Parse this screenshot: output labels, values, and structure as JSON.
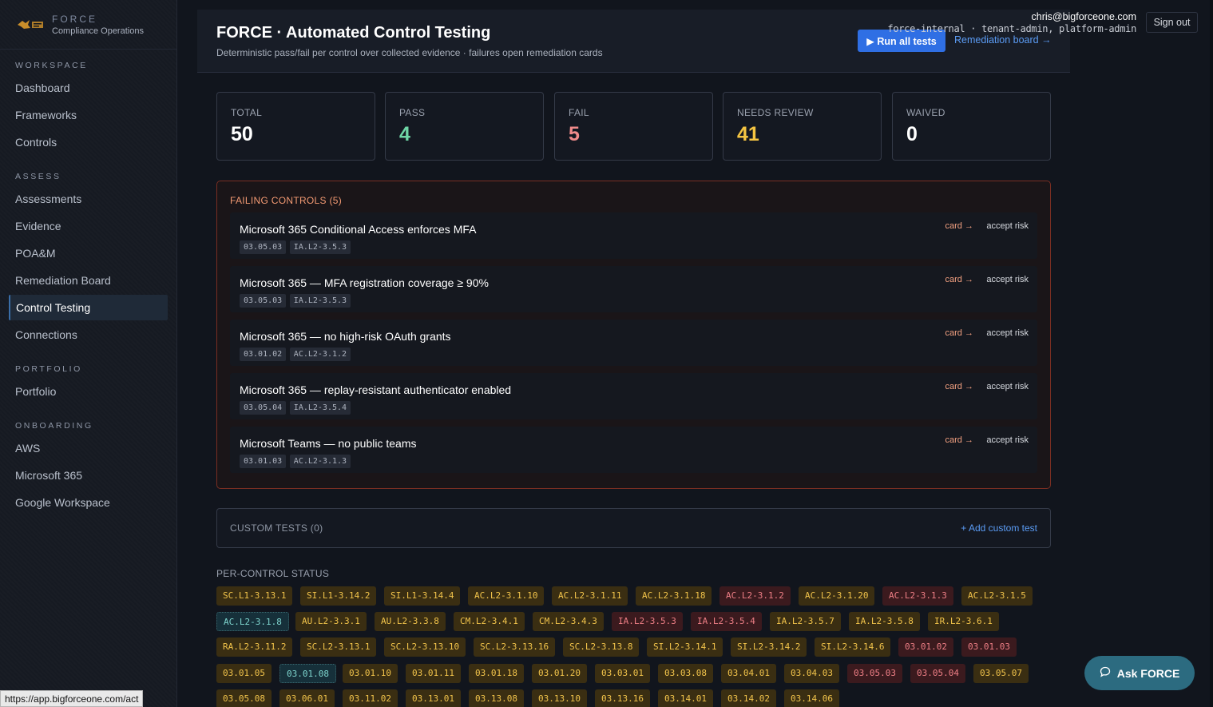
{
  "brand": {
    "name": "FORCE",
    "subtitle": "Compliance Operations"
  },
  "sidebar": {
    "sections": [
      {
        "label": "WORKSPACE",
        "items": [
          "Dashboard",
          "Frameworks",
          "Controls"
        ]
      },
      {
        "label": "ASSESS",
        "items": [
          "Assessments",
          "Evidence",
          "POA&M",
          "Remediation Board",
          "Control Testing",
          "Connections"
        ]
      },
      {
        "label": "PORTFOLIO",
        "items": [
          "Portfolio"
        ]
      },
      {
        "label": "ONBOARDING",
        "items": [
          "AWS",
          "Microsoft 365",
          "Google Workspace"
        ]
      }
    ],
    "active": "Control Testing"
  },
  "header": {
    "title": "FORCE · Automated Control Testing",
    "subtitle": "Deterministic pass/fail per control over collected evidence · failures open remediation cards",
    "run_button": "▶ Run all tests",
    "remediation_link": "Remediation board →"
  },
  "user": {
    "email": "chris@bigforceone.com",
    "roles": "force-internal · tenant-admin, platform-admin",
    "signout": "Sign out"
  },
  "stats": [
    {
      "label": "TOTAL",
      "value": "50",
      "color": "#ffffff"
    },
    {
      "label": "PASS",
      "value": "4",
      "color": "#6fd6a6"
    },
    {
      "label": "FAIL",
      "value": "5",
      "color": "#f08b8b"
    },
    {
      "label": "NEEDS REVIEW",
      "value": "41",
      "color": "#f5c542"
    },
    {
      "label": "WAIVED",
      "value": "0",
      "color": "#ffffff"
    }
  ],
  "failing": {
    "title": "FAILING CONTROLS (5)",
    "card_label": "card →",
    "accept_label": "accept risk",
    "rows": [
      {
        "name": "Microsoft 365 Conditional Access enforces MFA",
        "tags": [
          "03.05.03",
          "IA.L2-3.5.3"
        ]
      },
      {
        "name": "Microsoft 365 — MFA registration coverage ≥ 90%",
        "tags": [
          "03.05.03",
          "IA.L2-3.5.3"
        ]
      },
      {
        "name": "Microsoft 365 — no high-risk OAuth grants",
        "tags": [
          "03.01.02",
          "AC.L2-3.1.2"
        ]
      },
      {
        "name": "Microsoft 365 — replay-resistant authenticator enabled",
        "tags": [
          "03.05.04",
          "IA.L2-3.5.4"
        ]
      },
      {
        "name": "Microsoft Teams — no public teams",
        "tags": [
          "03.01.03",
          "AC.L2-3.1.3"
        ]
      }
    ]
  },
  "custom_tests": {
    "title": "CUSTOM TESTS (0)",
    "add_label": "+ Add custom test"
  },
  "per_control": {
    "title": "PER-CONTROL STATUS",
    "rows": [
      [
        [
          "SC.L1-3.13.1",
          "warn"
        ],
        [
          "SI.L1-3.14.2",
          "warn"
        ],
        [
          "SI.L1-3.14.4",
          "warn"
        ],
        [
          "AC.L2-3.1.10",
          "warn"
        ],
        [
          "AC.L2-3.1.11",
          "warn"
        ],
        [
          "AC.L2-3.1.18",
          "warn"
        ],
        [
          "AC.L2-3.1.2",
          "fail"
        ],
        [
          "AC.L2-3.1.20",
          "warn"
        ],
        [
          "AC.L2-3.1.3",
          "fail"
        ],
        [
          "AC.L2-3.1.5",
          "warn"
        ]
      ],
      [
        [
          "AC.L2-3.1.8",
          "pass"
        ],
        [
          "AU.L2-3.3.1",
          "warn"
        ],
        [
          "AU.L2-3.3.8",
          "warn"
        ],
        [
          "CM.L2-3.4.1",
          "warn"
        ],
        [
          "CM.L2-3.4.3",
          "warn"
        ],
        [
          "IA.L2-3.5.3",
          "fail"
        ],
        [
          "IA.L2-3.5.4",
          "fail"
        ],
        [
          "IA.L2-3.5.7",
          "warn"
        ],
        [
          "IA.L2-3.5.8",
          "warn"
        ],
        [
          "IR.L2-3.6.1",
          "warn"
        ]
      ],
      [
        [
          "RA.L2-3.11.2",
          "warn"
        ],
        [
          "SC.L2-3.13.1",
          "warn"
        ],
        [
          "SC.L2-3.13.10",
          "warn"
        ],
        [
          "SC.L2-3.13.16",
          "warn"
        ],
        [
          "SC.L2-3.13.8",
          "warn"
        ],
        [
          "SI.L2-3.14.1",
          "warn"
        ],
        [
          "SI.L2-3.14.2",
          "warn"
        ],
        [
          "SI.L2-3.14.6",
          "warn"
        ],
        [
          "03.01.02",
          "fail"
        ],
        [
          "03.01.03",
          "fail"
        ]
      ],
      [
        [
          "03.01.05",
          "warn"
        ],
        [
          "03.01.08",
          "pass"
        ],
        [
          "03.01.10",
          "warn"
        ],
        [
          "03.01.11",
          "warn"
        ],
        [
          "03.01.18",
          "warn"
        ],
        [
          "03.01.20",
          "warn"
        ],
        [
          "03.03.01",
          "warn"
        ],
        [
          "03.03.08",
          "warn"
        ],
        [
          "03.04.01",
          "warn"
        ],
        [
          "03.04.03",
          "warn"
        ],
        [
          "03.05.03",
          "fail"
        ],
        [
          "03.05.04",
          "fail"
        ],
        [
          "03.05.07",
          "warn"
        ]
      ],
      [
        [
          "03.05.08",
          "warn"
        ],
        [
          "03.06.01",
          "warn"
        ],
        [
          "03.11.02",
          "warn"
        ],
        [
          "03.13.01",
          "warn"
        ],
        [
          "03.13.08",
          "warn"
        ],
        [
          "03.13.10",
          "warn"
        ],
        [
          "03.13.16",
          "warn"
        ],
        [
          "03.14.01",
          "warn"
        ],
        [
          "03.14.02",
          "warn"
        ],
        [
          "03.14.06",
          "warn"
        ]
      ]
    ]
  },
  "assistant": {
    "label": "Ask FORCE",
    "icon": "chat-bubble-icon"
  },
  "browser_status": {
    "url": "https://app.bigforceone.com/act"
  }
}
